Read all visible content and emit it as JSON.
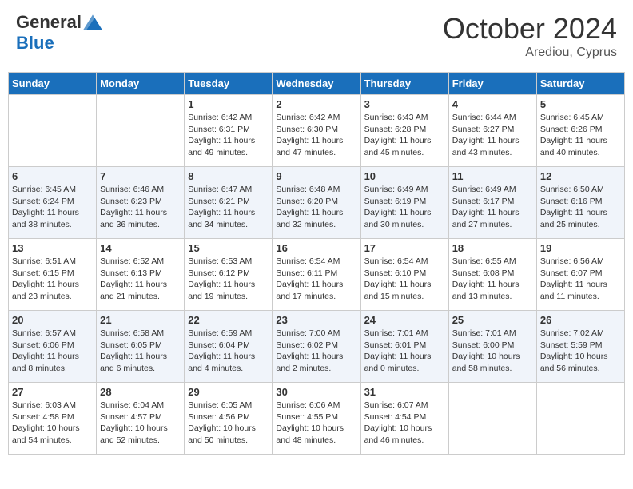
{
  "header": {
    "logo": {
      "general": "General",
      "blue": "Blue"
    },
    "title": "October 2024",
    "subtitle": "Arediou, Cyprus"
  },
  "weekdays": [
    "Sunday",
    "Monday",
    "Tuesday",
    "Wednesday",
    "Thursday",
    "Friday",
    "Saturday"
  ],
  "weeks": [
    [
      {
        "day": "",
        "info": ""
      },
      {
        "day": "",
        "info": ""
      },
      {
        "day": "1",
        "info": "Sunrise: 6:42 AM\nSunset: 6:31 PM\nDaylight: 11 hours and 49 minutes."
      },
      {
        "day": "2",
        "info": "Sunrise: 6:42 AM\nSunset: 6:30 PM\nDaylight: 11 hours and 47 minutes."
      },
      {
        "day": "3",
        "info": "Sunrise: 6:43 AM\nSunset: 6:28 PM\nDaylight: 11 hours and 45 minutes."
      },
      {
        "day": "4",
        "info": "Sunrise: 6:44 AM\nSunset: 6:27 PM\nDaylight: 11 hours and 43 minutes."
      },
      {
        "day": "5",
        "info": "Sunrise: 6:45 AM\nSunset: 6:26 PM\nDaylight: 11 hours and 40 minutes."
      }
    ],
    [
      {
        "day": "6",
        "info": "Sunrise: 6:45 AM\nSunset: 6:24 PM\nDaylight: 11 hours and 38 minutes."
      },
      {
        "day": "7",
        "info": "Sunrise: 6:46 AM\nSunset: 6:23 PM\nDaylight: 11 hours and 36 minutes."
      },
      {
        "day": "8",
        "info": "Sunrise: 6:47 AM\nSunset: 6:21 PM\nDaylight: 11 hours and 34 minutes."
      },
      {
        "day": "9",
        "info": "Sunrise: 6:48 AM\nSunset: 6:20 PM\nDaylight: 11 hours and 32 minutes."
      },
      {
        "day": "10",
        "info": "Sunrise: 6:49 AM\nSunset: 6:19 PM\nDaylight: 11 hours and 30 minutes."
      },
      {
        "day": "11",
        "info": "Sunrise: 6:49 AM\nSunset: 6:17 PM\nDaylight: 11 hours and 27 minutes."
      },
      {
        "day": "12",
        "info": "Sunrise: 6:50 AM\nSunset: 6:16 PM\nDaylight: 11 hours and 25 minutes."
      }
    ],
    [
      {
        "day": "13",
        "info": "Sunrise: 6:51 AM\nSunset: 6:15 PM\nDaylight: 11 hours and 23 minutes."
      },
      {
        "day": "14",
        "info": "Sunrise: 6:52 AM\nSunset: 6:13 PM\nDaylight: 11 hours and 21 minutes."
      },
      {
        "day": "15",
        "info": "Sunrise: 6:53 AM\nSunset: 6:12 PM\nDaylight: 11 hours and 19 minutes."
      },
      {
        "day": "16",
        "info": "Sunrise: 6:54 AM\nSunset: 6:11 PM\nDaylight: 11 hours and 17 minutes."
      },
      {
        "day": "17",
        "info": "Sunrise: 6:54 AM\nSunset: 6:10 PM\nDaylight: 11 hours and 15 minutes."
      },
      {
        "day": "18",
        "info": "Sunrise: 6:55 AM\nSunset: 6:08 PM\nDaylight: 11 hours and 13 minutes."
      },
      {
        "day": "19",
        "info": "Sunrise: 6:56 AM\nSunset: 6:07 PM\nDaylight: 11 hours and 11 minutes."
      }
    ],
    [
      {
        "day": "20",
        "info": "Sunrise: 6:57 AM\nSunset: 6:06 PM\nDaylight: 11 hours and 8 minutes."
      },
      {
        "day": "21",
        "info": "Sunrise: 6:58 AM\nSunset: 6:05 PM\nDaylight: 11 hours and 6 minutes."
      },
      {
        "day": "22",
        "info": "Sunrise: 6:59 AM\nSunset: 6:04 PM\nDaylight: 11 hours and 4 minutes."
      },
      {
        "day": "23",
        "info": "Sunrise: 7:00 AM\nSunset: 6:02 PM\nDaylight: 11 hours and 2 minutes."
      },
      {
        "day": "24",
        "info": "Sunrise: 7:01 AM\nSunset: 6:01 PM\nDaylight: 11 hours and 0 minutes."
      },
      {
        "day": "25",
        "info": "Sunrise: 7:01 AM\nSunset: 6:00 PM\nDaylight: 10 hours and 58 minutes."
      },
      {
        "day": "26",
        "info": "Sunrise: 7:02 AM\nSunset: 5:59 PM\nDaylight: 10 hours and 56 minutes."
      }
    ],
    [
      {
        "day": "27",
        "info": "Sunrise: 6:03 AM\nSunset: 4:58 PM\nDaylight: 10 hours and 54 minutes."
      },
      {
        "day": "28",
        "info": "Sunrise: 6:04 AM\nSunset: 4:57 PM\nDaylight: 10 hours and 52 minutes."
      },
      {
        "day": "29",
        "info": "Sunrise: 6:05 AM\nSunset: 4:56 PM\nDaylight: 10 hours and 50 minutes."
      },
      {
        "day": "30",
        "info": "Sunrise: 6:06 AM\nSunset: 4:55 PM\nDaylight: 10 hours and 48 minutes."
      },
      {
        "day": "31",
        "info": "Sunrise: 6:07 AM\nSunset: 4:54 PM\nDaylight: 10 hours and 46 minutes."
      },
      {
        "day": "",
        "info": ""
      },
      {
        "day": "",
        "info": ""
      }
    ]
  ]
}
